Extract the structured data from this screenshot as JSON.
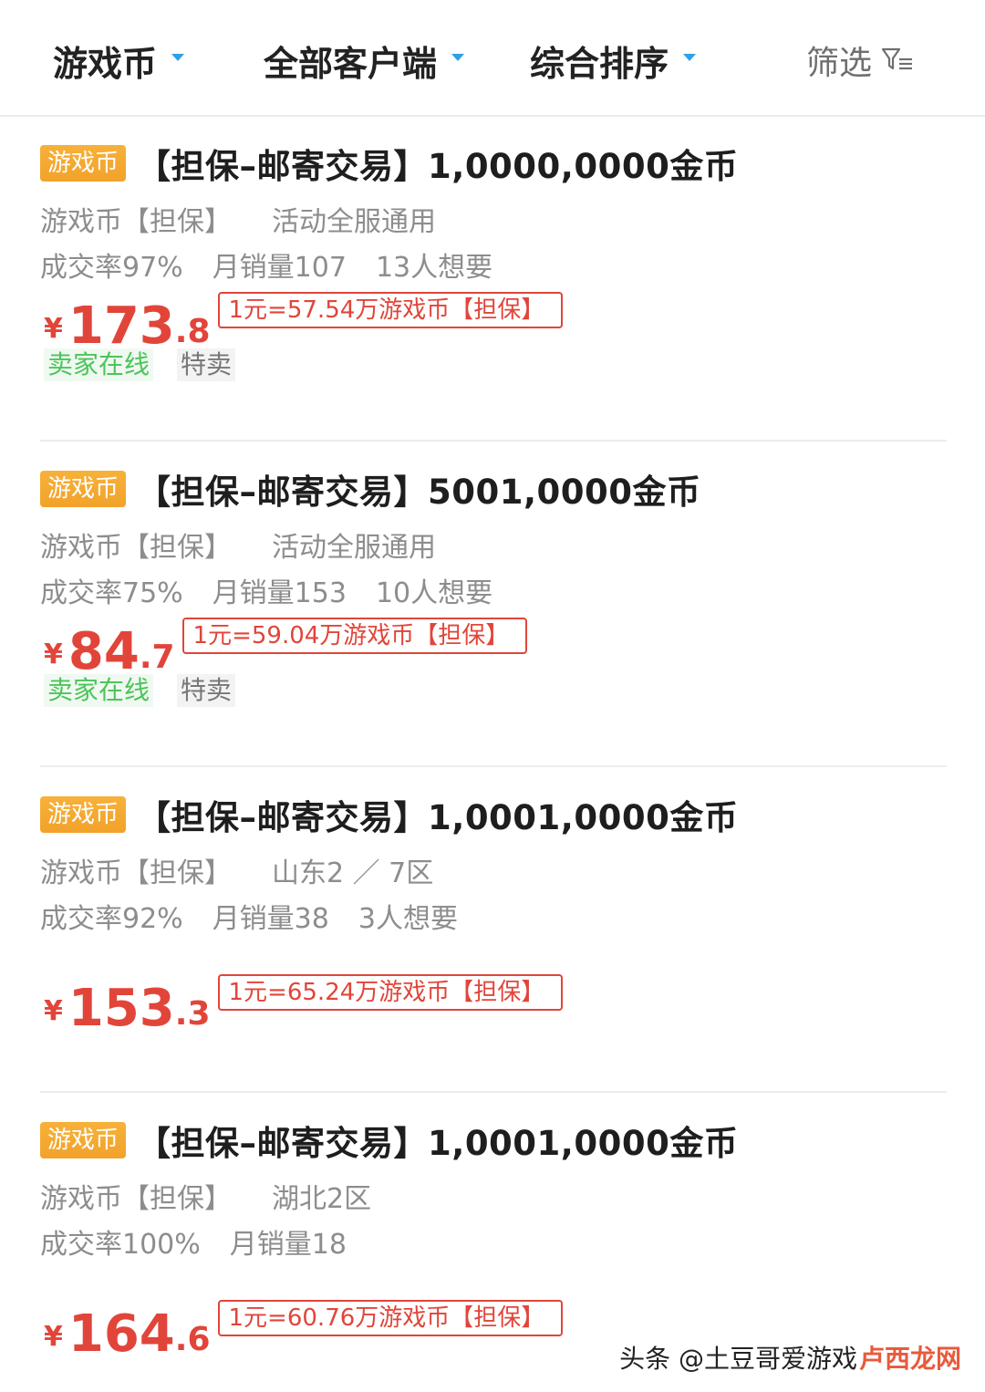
{
  "filters": {
    "category": "游戏币",
    "client": "全部客户端",
    "sort": "综合排序",
    "filter": "筛选"
  },
  "listings": [
    {
      "badge": "游戏币",
      "title": "【担保–邮寄交易】1,0000,0000金币",
      "type": "游戏币【担保】",
      "server": "活动全服通用",
      "deal_rate": "成交率97%",
      "monthly_sales": "月销量107",
      "wanted": "13人想要",
      "currency": "¥",
      "price_int": "173",
      "price_dec": ".8",
      "rate": "1元=57.54万游戏币【担保】",
      "tags": [
        "卖家在线",
        "特卖"
      ]
    },
    {
      "badge": "游戏币",
      "title": "【担保–邮寄交易】5001,0000金币",
      "type": "游戏币【担保】",
      "server": "活动全服通用",
      "deal_rate": "成交率75%",
      "monthly_sales": "月销量153",
      "wanted": "10人想要",
      "currency": "¥",
      "price_int": "84",
      "price_dec": ".7",
      "rate": "1元=59.04万游戏币【担保】",
      "tags": [
        "卖家在线",
        "特卖"
      ]
    },
    {
      "badge": "游戏币",
      "title": "【担保–邮寄交易】1,0001,0000金币",
      "type": "游戏币【担保】",
      "server": "山东2 ／ 7区",
      "deal_rate": "成交率92%",
      "monthly_sales": "月销量38",
      "wanted": "3人想要",
      "currency": "¥",
      "price_int": "153",
      "price_dec": ".3",
      "rate": "1元=65.24万游戏币【担保】"
    },
    {
      "badge": "游戏币",
      "title": "【担保–邮寄交易】1,0001,0000金币",
      "type": "游戏币【担保】",
      "server": "湖北2区",
      "deal_rate": "成交率100%",
      "monthly_sales": "月销量18",
      "currency": "¥",
      "price_int": "164",
      "price_dec": ".6",
      "rate": "1元=60.76万游戏币【担保】"
    }
  ],
  "watermark": {
    "text": "头条 @土豆哥爱游戏",
    "logo_text": "卢西龙网"
  },
  "colors": {
    "accent_price": "#e1453a",
    "badge": "#f5a623",
    "online": "#4cc45a",
    "caret": "#2fa1e6"
  }
}
